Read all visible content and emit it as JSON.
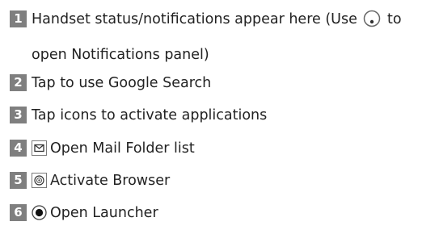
{
  "items": [
    {
      "number": "1",
      "text_before_icon": "Handset status/notifications appear here (Use ",
      "icon": "notification-circle-icon",
      "text_after_icon": " to",
      "text_line2": "open Notifications panel)"
    },
    {
      "number": "2",
      "text": "Tap to use Google Search"
    },
    {
      "number": "3",
      "text": "Tap icons to activate applications"
    },
    {
      "number": "4",
      "icon": "mail-icon",
      "text": "Open Mail Folder list"
    },
    {
      "number": "5",
      "icon": "browser-globe-icon",
      "text": "Activate Browser"
    },
    {
      "number": "6",
      "icon": "launcher-dot-icon",
      "text": "Open Launcher"
    }
  ],
  "colors": {
    "badge_bg": "#7f7f7f",
    "text": "#222222",
    "icon_border": "#7a7a7a"
  }
}
